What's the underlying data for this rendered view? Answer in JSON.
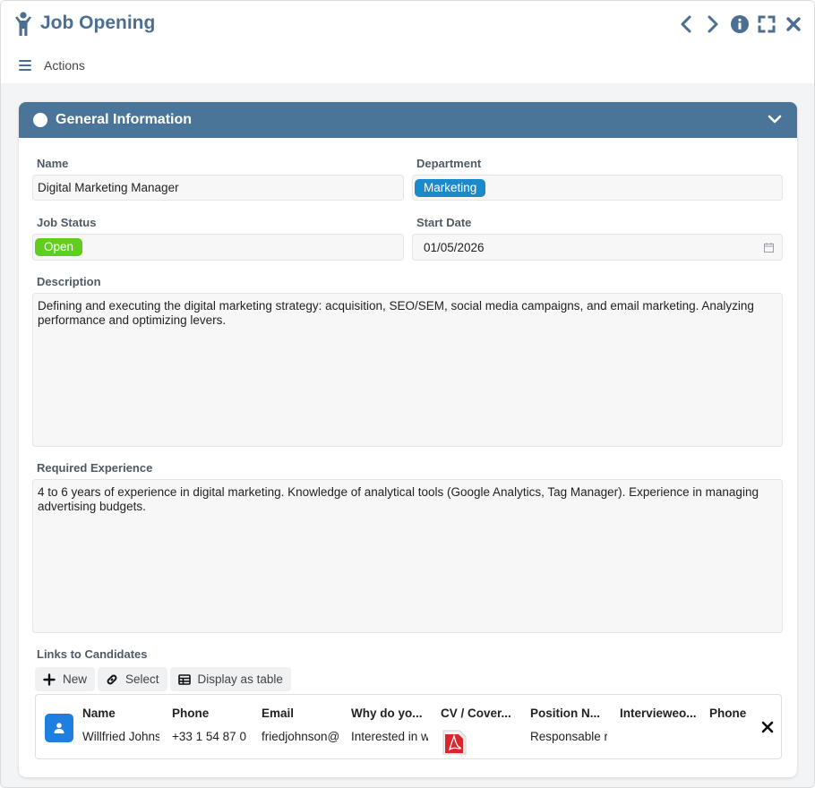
{
  "window": {
    "title": "Job Opening",
    "icon": "person-icon",
    "controls": [
      "prev-icon",
      "next-icon",
      "info-icon",
      "fullscreen-icon",
      "close-icon"
    ],
    "accent_color": "#4b6f92"
  },
  "toolbar": {
    "actions_label": "Actions"
  },
  "section": {
    "title": "General Information",
    "header_color": "#4a7599"
  },
  "form": {
    "name": {
      "label": "Name",
      "value": "Digital Marketing Manager"
    },
    "department": {
      "label": "Department",
      "value": "Marketing",
      "color": "#1b8acb"
    },
    "job_status": {
      "label": "Job Status",
      "value": "Open",
      "color": "#5fce1c"
    },
    "start_date": {
      "label": "Start Date",
      "value": "01/05/2026"
    },
    "description": {
      "label": "Description",
      "value": "Defining and executing the digital marketing strategy: acquisition, SEO/SEM, social media campaigns, and email marketing. Analyzing performance and optimizing levers."
    },
    "required_experience": {
      "label": "Required Experience",
      "value": "4 to 6 years of experience in digital marketing. Knowledge of analytical tools (Google Analytics, Tag Manager). Experience in managing advertising budgets."
    }
  },
  "candidates": {
    "label": "Links to Candidates",
    "buttons": {
      "new": "New",
      "select": "Select",
      "display_table": "Display as table"
    },
    "columns": [
      "Name",
      "Phone",
      "Email",
      "Why do yo...",
      "CV / Cover...",
      "Position N...",
      "Intervieweo...",
      "Phone"
    ],
    "row": {
      "name": "Willfried Johns",
      "phone": "+33 1 54 87 0",
      "email": "friedjohnson@",
      "why": "Interested in w",
      "cv": "pdf-icon",
      "position": "Responsable r",
      "interviewed": "",
      "phone2": ""
    }
  }
}
